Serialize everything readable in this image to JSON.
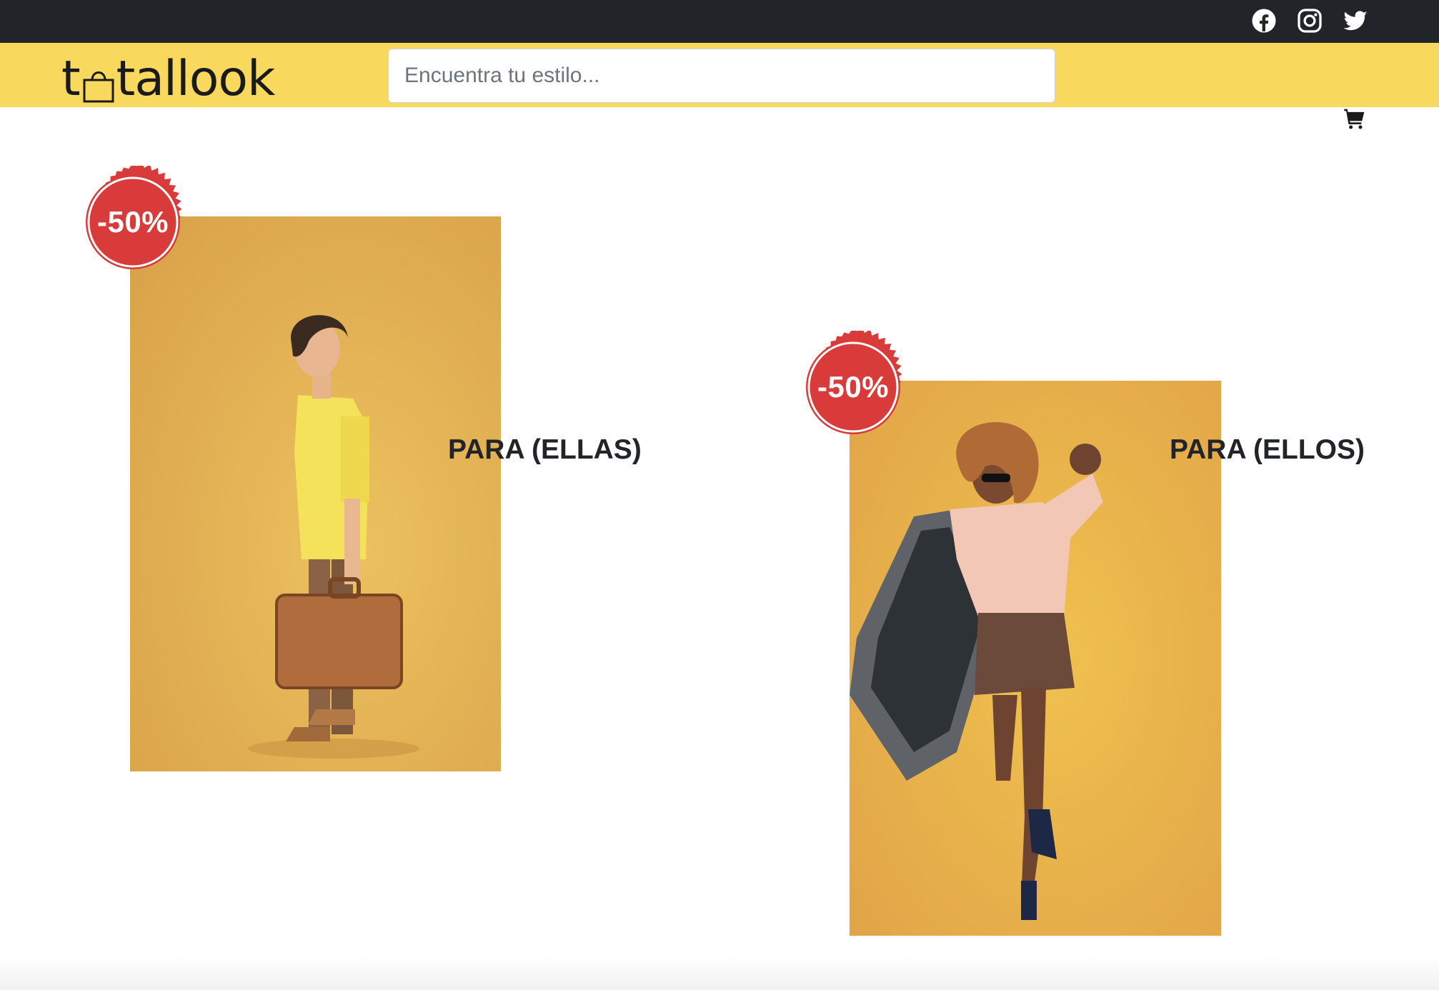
{
  "topbar": {
    "social_icons": [
      "facebook-icon",
      "instagram-icon",
      "twitter-icon"
    ]
  },
  "navbar": {
    "logo_prefix": "t",
    "logo_suffix": "tallook",
    "logo_icon": "shopping-bag-icon",
    "search_placeholder": "Encuentra tu estilo...",
    "cart_icon": "cart-icon"
  },
  "products": [
    {
      "badge": "-50%",
      "caption": "PARA (ELLAS)"
    },
    {
      "badge": "-50%",
      "caption": "PARA (ELLOS)"
    }
  ],
  "colors": {
    "topbar": "#212529",
    "navbar": "#f8d95d",
    "badge": "#d93a3a",
    "photo_background": "#e8b550",
    "text": "#212529"
  }
}
